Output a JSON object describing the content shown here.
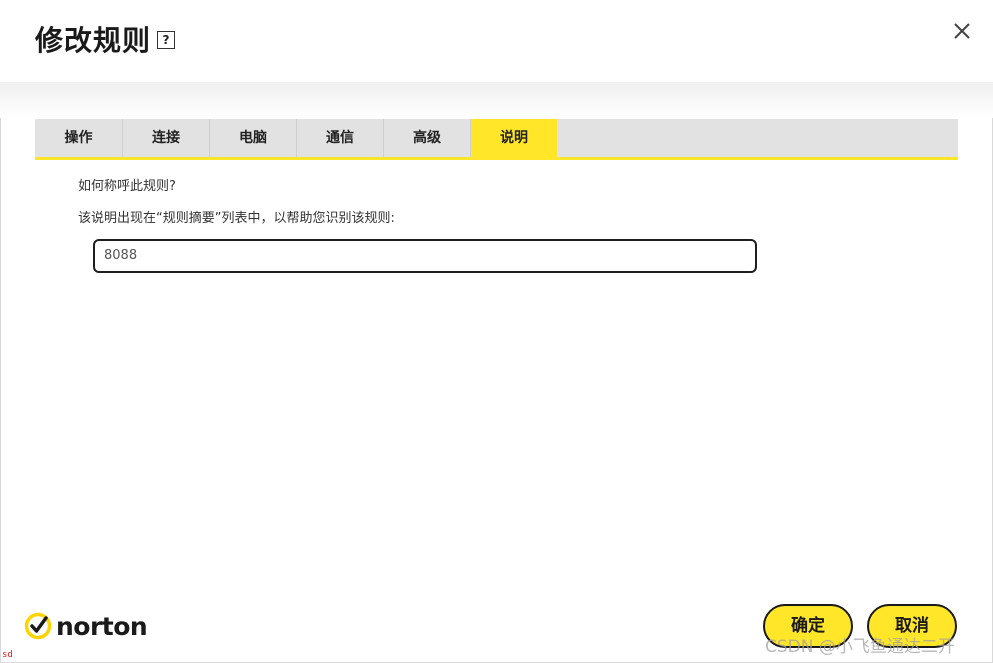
{
  "dialog": {
    "title": "修改规则",
    "help_icon": "?",
    "close_icon": "close-icon"
  },
  "tabs": [
    {
      "label": "操作",
      "active": false
    },
    {
      "label": "连接",
      "active": false
    },
    {
      "label": "电脑",
      "active": false
    },
    {
      "label": "通信",
      "active": false
    },
    {
      "label": "高级",
      "active": false
    },
    {
      "label": "说明",
      "active": true
    }
  ],
  "content": {
    "question": "如何称呼此规则?",
    "hint": "该说明出现在“规则摘要”列表中，以帮助您识别该规则:",
    "description_value": "8088"
  },
  "footer": {
    "brand": "norton",
    "ok_label": "确定",
    "cancel_label": "取消"
  },
  "overlay": {
    "watermark": "CSDN @小飞鱼通达二开",
    "corner_text": "sd"
  },
  "colors": {
    "accent": "#ffe629",
    "tab_bg": "#e2e2e2",
    "border_dark": "#1a1a1a"
  }
}
